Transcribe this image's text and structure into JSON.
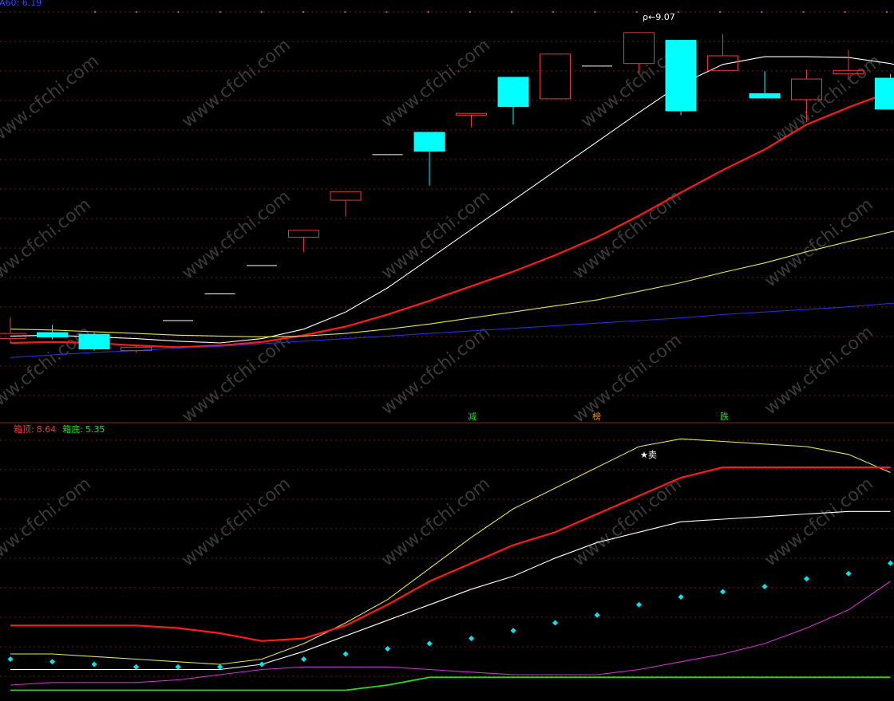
{
  "colors": {
    "background": "#000000",
    "grid": "#7a1212",
    "divider": "#9a1c1c",
    "up_candle": "#e03c3c",
    "down_candle": "#00ffff",
    "flat_candle": "#ffffff",
    "ma_white": "#ffffff",
    "ma_red": "#ff1a1a",
    "ma_yellow": "#e6e64d",
    "ma_blue": "#2a2ad9",
    "box_top": "#e6e64d",
    "box_mid": "#ff1a1a",
    "box_low": "#ffffff",
    "dots": "#00e5ee",
    "magenta": "#cc33cc",
    "green": "#22dd22",
    "watermark": "#3a3a3a"
  },
  "header": {
    "ma_label": "A60: 6.19"
  },
  "sub_header": {
    "top_label": "箱顶:",
    "top_value": "8.64",
    "bottom_label": "箱底:",
    "bottom_value": "5.35"
  },
  "markers": {
    "high_label": "9.07",
    "sell_label": "★卖"
  },
  "signals": [
    "减",
    "榜",
    "跌"
  ],
  "watermark_text": "www.cfchi.com",
  "chart_data": [
    {
      "type": "candlestick",
      "title": "",
      "ylim": [
        4.65,
        9.4
      ],
      "candles": [
        {
          "open": 5.6,
          "close": 5.66,
          "high": 5.85,
          "low": 5.55
        },
        {
          "open": 5.67,
          "close": 5.62,
          "high": 5.76,
          "low": 5.59
        },
        {
          "open": 5.65,
          "close": 5.48,
          "high": 5.67,
          "low": 5.46
        },
        {
          "open": 5.46,
          "close": 5.5,
          "high": 5.52,
          "low": 5.44
        },
        {
          "open": 5.81,
          "close": 5.81,
          "high": 5.81,
          "low": 5.81
        },
        {
          "open": 6.12,
          "close": 6.12,
          "high": 6.12,
          "low": 6.12
        },
        {
          "open": 6.45,
          "close": 6.45,
          "high": 6.45,
          "low": 6.45
        },
        {
          "open": 6.78,
          "close": 6.86,
          "high": 6.86,
          "low": 6.61
        },
        {
          "open": 7.21,
          "close": 7.31,
          "high": 7.31,
          "low": 7.02
        },
        {
          "open": 7.74,
          "close": 7.74,
          "high": 7.74,
          "low": 7.74
        },
        {
          "open": 8.0,
          "close": 7.78,
          "high": 8.0,
          "low": 7.38
        },
        {
          "open": 8.2,
          "close": 8.22,
          "high": 8.22,
          "low": 8.06
        },
        {
          "open": 8.64,
          "close": 8.3,
          "high": 8.64,
          "low": 8.09
        },
        {
          "open": 8.39,
          "close": 8.91,
          "high": 8.91,
          "low": 8.39
        },
        {
          "open": 8.77,
          "close": 8.77,
          "high": 8.77,
          "low": 8.77
        },
        {
          "open": 8.8,
          "close": 9.16,
          "high": 9.16,
          "low": 8.69
        },
        {
          "open": 9.07,
          "close": 8.25,
          "high": 9.07,
          "low": 8.2
        },
        {
          "open": 8.72,
          "close": 8.89,
          "high": 9.14,
          "low": 8.72
        },
        {
          "open": 8.45,
          "close": 8.4,
          "high": 8.71,
          "low": 8.4
        },
        {
          "open": 8.38,
          "close": 8.62,
          "high": 8.73,
          "low": 8.12
        },
        {
          "open": 8.68,
          "close": 8.72,
          "high": 8.96,
          "low": 8.61
        },
        {
          "open": 8.63,
          "close": 8.27,
          "high": 8.68,
          "low": 8.27
        }
      ],
      "series": [
        {
          "color": "#ffffff",
          "values": [
            5.63,
            5.64,
            5.62,
            5.6,
            5.57,
            5.55,
            5.6,
            5.71,
            5.91,
            6.19,
            6.53,
            6.87,
            7.21,
            7.55,
            7.89,
            8.23,
            8.56,
            8.79,
            8.88,
            8.88,
            8.87,
            8.8,
            8.68
          ]
        },
        {
          "color": "#ff1a1a",
          "values": [
            5.55,
            5.56,
            5.55,
            5.52,
            5.5,
            5.52,
            5.56,
            5.64,
            5.74,
            5.88,
            6.04,
            6.21,
            6.38,
            6.57,
            6.78,
            7.03,
            7.3,
            7.56,
            7.8,
            8.09,
            8.29,
            8.47,
            8.66
          ]
        },
        {
          "color": "#e6e64d",
          "values": [
            5.71,
            5.7,
            5.68,
            5.66,
            5.64,
            5.63,
            5.62,
            5.63,
            5.66,
            5.71,
            5.77,
            5.84,
            5.91,
            5.98,
            6.05,
            6.15,
            6.25,
            6.37,
            6.48,
            6.61,
            6.73,
            6.84,
            6.95
          ]
        },
        {
          "color": "#2a2ad9",
          "values": [
            5.38,
            5.41,
            5.44,
            5.46,
            5.49,
            5.51,
            5.54,
            5.57,
            5.6,
            5.63,
            5.66,
            5.69,
            5.72,
            5.75,
            5.78,
            5.81,
            5.84,
            5.88,
            5.91,
            5.94,
            5.97,
            6.01,
            6.04
          ]
        }
      ]
    },
    {
      "type": "line",
      "title": "",
      "ylim": [
        0,
        100
      ],
      "series": [
        {
          "color": "#e6e64d",
          "values": [
            16,
            16,
            15,
            14,
            13,
            12,
            14,
            20,
            28,
            37,
            49,
            61,
            72,
            80,
            88,
            96,
            99,
            98,
            97,
            96,
            93,
            86
          ]
        },
        {
          "color": "#ff1a1a",
          "values": [
            27,
            27,
            27,
            27,
            26,
            24,
            21,
            22,
            27,
            35,
            44,
            51,
            58,
            63,
            70,
            77,
            84,
            88,
            88,
            88,
            88,
            88
          ]
        },
        {
          "color": "#ffffff",
          "values": [
            10,
            10,
            10,
            10,
            10,
            10,
            12,
            17,
            23,
            29,
            35,
            41,
            46,
            53,
            59,
            63,
            67,
            68,
            69,
            70,
            71,
            71
          ]
        },
        {
          "color": "#cc33cc",
          "values": [
            4,
            5,
            5,
            5,
            6,
            8,
            10,
            11,
            11,
            11,
            10,
            9,
            8,
            8,
            8,
            10,
            13,
            16,
            20,
            26,
            33,
            44
          ]
        },
        {
          "color": "#22dd22",
          "values": [
            2,
            2,
            2,
            2,
            2,
            2,
            2,
            2,
            2,
            4,
            7,
            7,
            7,
            7,
            7,
            7,
            7,
            7,
            7,
            7,
            7,
            7
          ]
        },
        {
          "color": "#00e5ee",
          "style": "dots",
          "values": [
            14,
            13,
            12,
            11,
            11,
            11,
            12,
            14,
            16,
            18,
            20,
            22,
            25,
            28,
            31,
            35,
            38,
            40,
            42,
            45,
            47,
            51
          ]
        }
      ]
    }
  ]
}
